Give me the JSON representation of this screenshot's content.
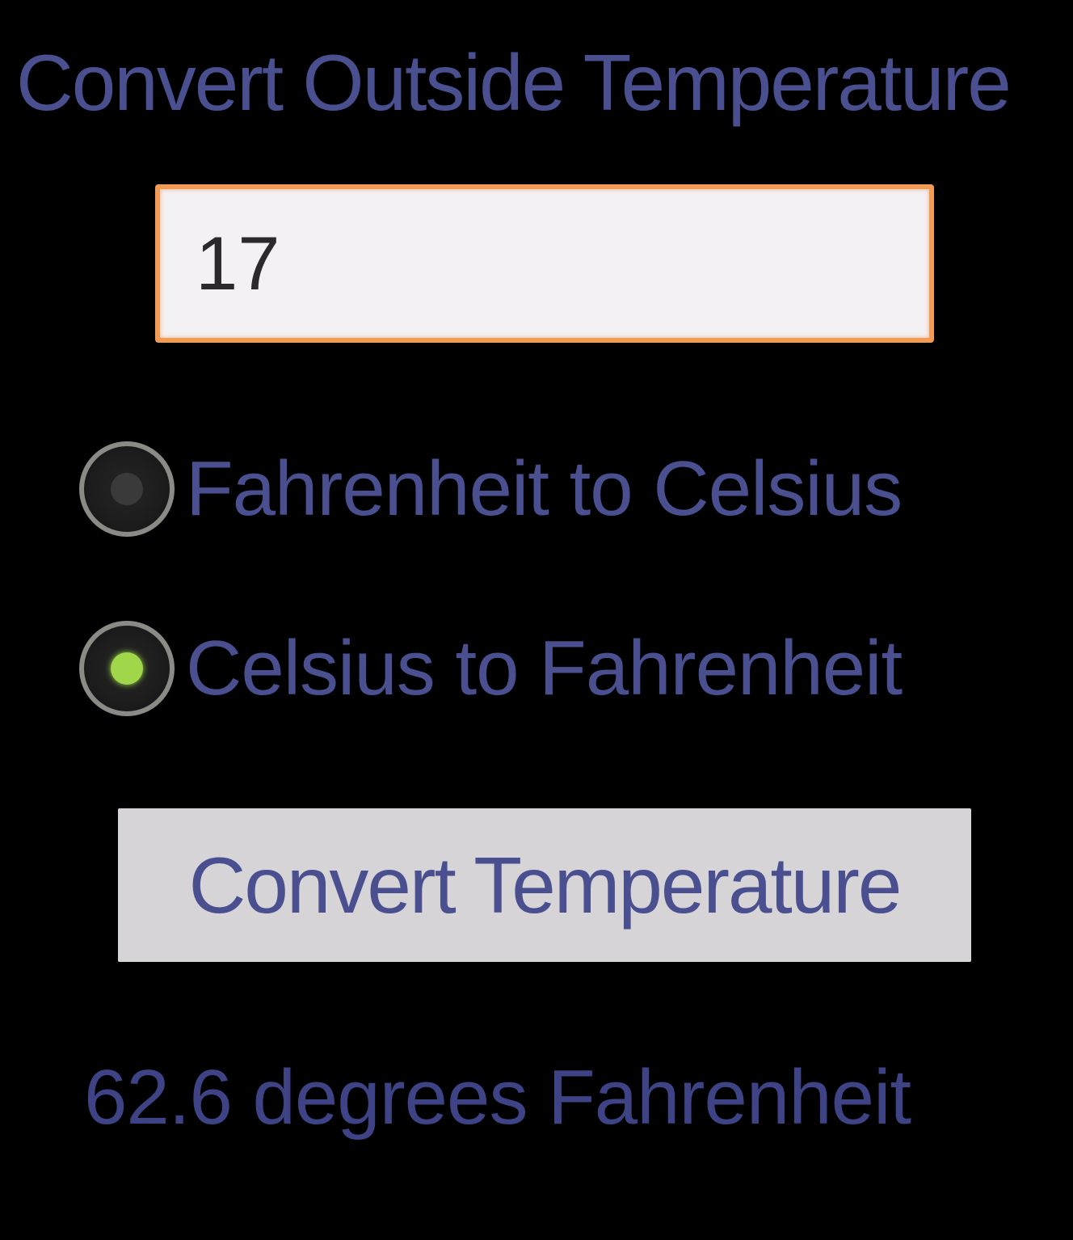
{
  "app": {
    "title": "Convert Outside Temperature"
  },
  "input": {
    "value": "17"
  },
  "conversion_options": [
    {
      "label": "Fahrenheit to Celsius",
      "selected": false
    },
    {
      "label": "Celsius to Fahrenheit",
      "selected": true
    }
  ],
  "convert_button": {
    "label": "Convert Temperature"
  },
  "result": {
    "text": "62.6 degrees Fahrenheit"
  },
  "colors": {
    "background": "#000000",
    "text": "#4a4f8f",
    "input_border": "#f29b57",
    "input_background": "#f4f1f4",
    "radio_selected": "#9fd64a",
    "button_background": "#d6d4d6"
  }
}
